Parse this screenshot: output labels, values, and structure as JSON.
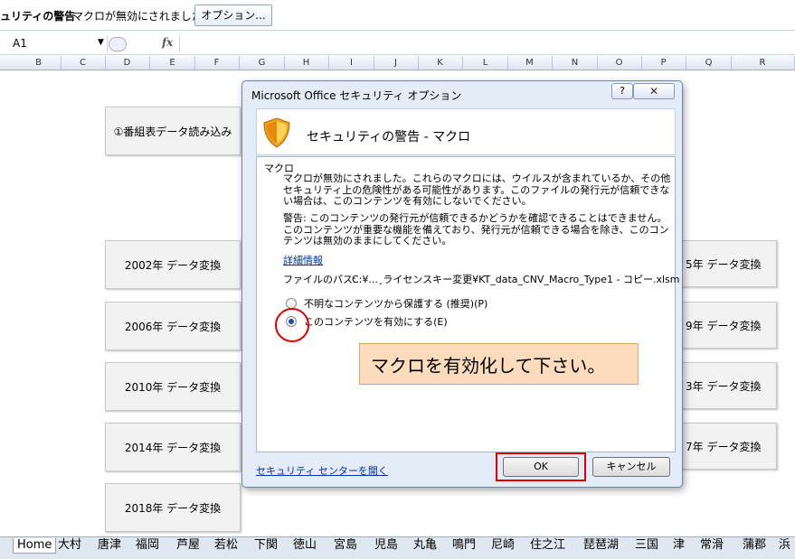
{
  "message_bar": {
    "title": "ュリティの警告",
    "text": "マクロが無効にされました。",
    "options_button": "オプション..."
  },
  "formula_bar": {
    "name_box": "A1",
    "fx": "fx",
    "formula": ""
  },
  "columns": [
    "B",
    "C",
    "D",
    "E",
    "F",
    "G",
    "H",
    "I",
    "J",
    "K",
    "L",
    "M",
    "N",
    "O",
    "P",
    "Q",
    "R"
  ],
  "sheet_buttons": {
    "load": "①番組表データ読み込み",
    "left": [
      "2002年 データ変換",
      "2006年 データ変換",
      "2010年 データ変換",
      "2014年 データ変換",
      "2018年 データ変換"
    ],
    "right": [
      "5年 データ変換",
      "9年 データ変換",
      "3年 データ変換",
      "7年 データ変換"
    ]
  },
  "dialog": {
    "title": "Microsoft Office セキュリティ オプション",
    "help": "?",
    "close": "✕",
    "heading": "セキュリティの警告 - マクロ",
    "group_label": "マクロ",
    "para1": "マクロが無効にされました。これらのマクロには、ウイルスが含まれているか、その他セキュリティ上の危険性がある可能性があります。このファイルの発行元が信頼できない場合は、このコンテンツを有効にしないでください。",
    "para2": "警告: このコンテンツの発行元が信頼できるかどうかを確認できることはできません。このコンテンツが重要な機能を備えており、発行元が信頼できる場合を除き、このコンテンツは無効のままにしてください。",
    "details_link": "詳細情報",
    "file_path_label": "ファイルのパス:",
    "file_path_value": "C:¥...¸ライセンスキー変更¥KT_data_CNV_Macro_Type1 - コピー.xlsm",
    "radio1": "不明なコンテンツから保護する (推奨)(P)",
    "radio2": "このコンテンツを有効にする(E)",
    "radio_selected": 2,
    "note": "マクロを有効化して下さい。",
    "trust_center_link": "セキュリティ センターを開く",
    "ok": "OK",
    "cancel": "キャンセル"
  },
  "sheet_tabs": [
    "Home",
    "大村",
    "唐津",
    "福岡",
    "芦屋",
    "若松",
    "下関",
    "徳山",
    "宮島",
    "児島",
    "丸亀",
    "鳴門",
    "尼崎",
    "住之江",
    "琵琶湖",
    "三国",
    "津",
    "常滑",
    "蒲郡",
    "浜"
  ],
  "colors": {
    "highlight_red": "#e00000",
    "note_bg": "#fcdcbc",
    "link": "#0033aa"
  }
}
